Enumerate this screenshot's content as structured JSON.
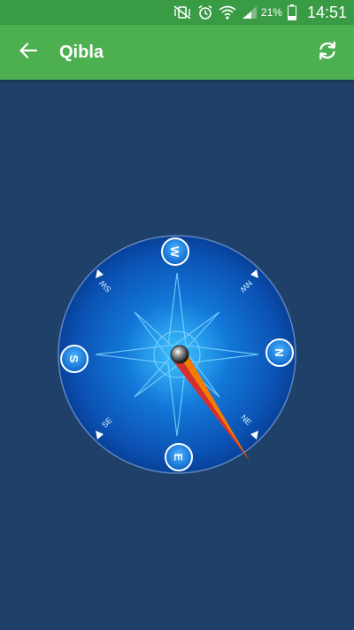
{
  "status_bar": {
    "battery_percent": "21%",
    "time": "14:51",
    "icons": [
      "vibrate-off-icon",
      "alarm-icon",
      "wifi-icon",
      "signal-icon",
      "battery-icon"
    ]
  },
  "app_bar": {
    "title": "Qibla",
    "back_icon": "arrow-back-icon",
    "refresh_icon": "refresh-icon"
  },
  "compass": {
    "cardinals": {
      "north": "N",
      "south": "S",
      "east": "E",
      "west": "W"
    },
    "intercardinals": {
      "ne": "NE",
      "nw": "NW",
      "se": "SE",
      "sw": "SW"
    }
  },
  "colors": {
    "status_bar": "#3a9b45",
    "app_bar": "#4caf50",
    "background": "#1f4068",
    "needle_orange": "#f57c00",
    "needle_red": "#d32f2f"
  }
}
